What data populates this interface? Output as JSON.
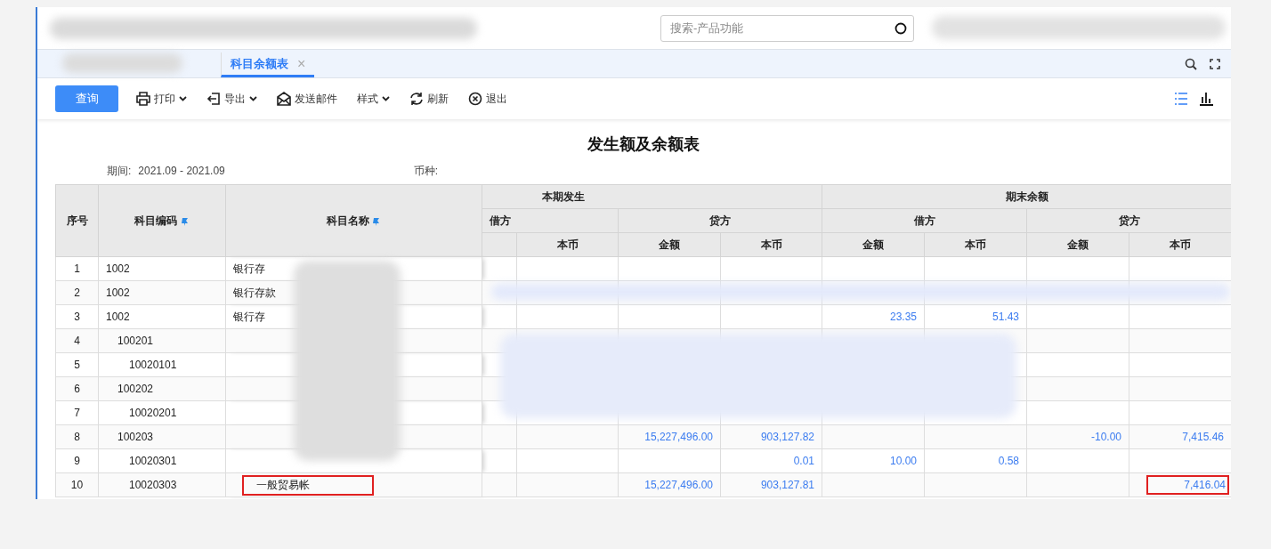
{
  "search": {
    "placeholder": "搜索-产品功能"
  },
  "tabs": [
    {
      "label": "科目余额表",
      "selected": true,
      "close": "×"
    }
  ],
  "toolbar": {
    "query_button": "查询",
    "actions": [
      {
        "kind": "print",
        "label": "打印",
        "dropdown": true
      },
      {
        "kind": "export",
        "label": "导出",
        "dropdown": true
      },
      {
        "kind": "mail",
        "label": "发送邮件"
      },
      {
        "kind": "style",
        "label": "样式",
        "dropdown": true
      },
      {
        "kind": "refresh",
        "label": "刷新"
      },
      {
        "kind": "exit",
        "label": "退出"
      }
    ],
    "views": [
      {
        "kind": "list",
        "selected": true
      },
      {
        "kind": "chart",
        "selected": false
      }
    ]
  },
  "report": {
    "title": "发生额及余额表",
    "period_label": "期间:",
    "period": "2021.09 - 2021.09",
    "currency_label": "币种:"
  },
  "table": {
    "head": {
      "no": "序号",
      "code": "科目编码",
      "name": "科目名称",
      "groups": [
        "本期发生",
        "期末余额"
      ],
      "subgroups": [
        "借方",
        "贷方",
        "借方",
        "贷方"
      ],
      "columns": [
        "本币",
        "金额",
        "本币",
        "金额",
        "本币",
        "金额",
        "本币"
      ]
    },
    "rows": [
      {
        "no": "1",
        "code": "1002",
        "name": "银行存"
      },
      {
        "no": "2",
        "code": "1002",
        "name": "银行存款"
      },
      {
        "no": "3",
        "code": "1002",
        "name": "银行存",
        "values": {
          "end_dr_amount": "23.35",
          "end_dr_local": "51.43"
        },
        "children": [
          {
            "no": "4",
            "code": "100201",
            "children": [
              {
                "no": "5",
                "code": "10020101"
              }
            ]
          },
          {
            "no": "6",
            "code": "100202",
            "children": [
              {
                "no": "7",
                "code": "10020201"
              }
            ]
          },
          {
            "no": "8",
            "code": "100203",
            "values": {
              "cur_cr_amount": "15,227,496.00",
              "cur_cr_local": "903,127.82",
              "end_cr_amount": "-10.00",
              "end_cr_local": "7,415.46"
            },
            "children": [
              {
                "no": "9",
                "code": "10020301",
                "values": {
                  "cur_cr_local": "0.01",
                  "end_dr_amount": "10.00",
                  "end_dr_local": "0.58"
                }
              },
              {
                "no": "10",
                "code": "10020303",
                "name": "一般贸易帐",
                "highlight": true,
                "values": {
                  "cur_cr_amount": "15,227,496.00",
                  "cur_cr_local": "903,127.81",
                  "end_cr_local": "7,416.04"
                }
              }
            ]
          }
        ]
      }
    ]
  }
}
